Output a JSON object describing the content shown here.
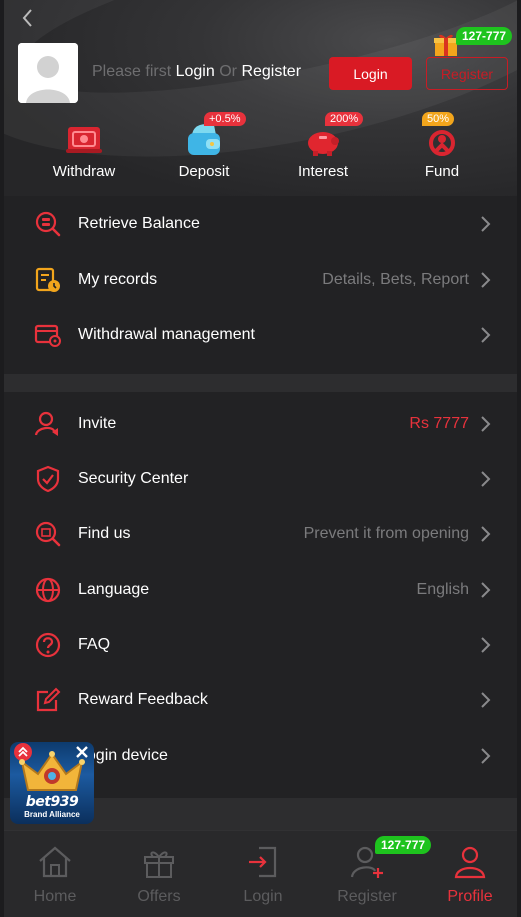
{
  "header": {
    "prompt_prefix": "Please first",
    "prompt_login": "Login",
    "prompt_or": "Or",
    "prompt_register": "Register",
    "login_button": "Login",
    "register_button": "Register",
    "promo_badge": "127-777"
  },
  "quick_actions": [
    {
      "label": "Withdraw",
      "icon": "withdraw-icon",
      "tag": ""
    },
    {
      "label": "Deposit",
      "icon": "wallet-icon",
      "tag": "+0.5%"
    },
    {
      "label": "Interest",
      "icon": "piggy-bank-icon",
      "tag": "200%"
    },
    {
      "label": "Fund",
      "icon": "fund-icon",
      "tag": "50%"
    }
  ],
  "menu_group_1": [
    {
      "label": "Retrieve Balance",
      "value": "",
      "icon": "retrieve-balance-icon"
    },
    {
      "label": "My records",
      "value": "Details, Bets, Report",
      "icon": "records-icon"
    },
    {
      "label": "Withdrawal management",
      "value": "",
      "icon": "withdrawal-management-icon"
    }
  ],
  "menu_group_2": [
    {
      "label": "Invite",
      "value": "Rs 7777",
      "icon": "invite-icon"
    },
    {
      "label": "Security Center",
      "value": "",
      "icon": "shield-icon"
    },
    {
      "label": "Find us",
      "value": "Prevent it from opening",
      "icon": "find-us-icon"
    },
    {
      "label": "Language",
      "value": "English",
      "icon": "globe-icon"
    },
    {
      "label": "FAQ",
      "value": "",
      "icon": "question-icon"
    },
    {
      "label": "Reward Feedback",
      "value": "",
      "icon": "edit-icon"
    },
    {
      "label": "Login device",
      "value": "",
      "icon": "device-icon"
    }
  ],
  "floating_ad": {
    "logo_text": "bet939",
    "sub_text": "Brand Alliance"
  },
  "bottom_nav": {
    "tabs": [
      {
        "label": "Home",
        "icon": "home-icon"
      },
      {
        "label": "Offers",
        "icon": "gift-icon"
      },
      {
        "label": "Login",
        "icon": "login-icon"
      },
      {
        "label": "Register",
        "icon": "add-user-icon"
      },
      {
        "label": "Profile",
        "icon": "profile-icon"
      }
    ],
    "register_badge": "127-777",
    "active": "Profile"
  },
  "colors": {
    "accent": "#e8323c",
    "button_red": "#d91a24",
    "badge_green": "#1ec31e",
    "background": "#1f1f21",
    "muted_text": "#7b7b7d"
  }
}
